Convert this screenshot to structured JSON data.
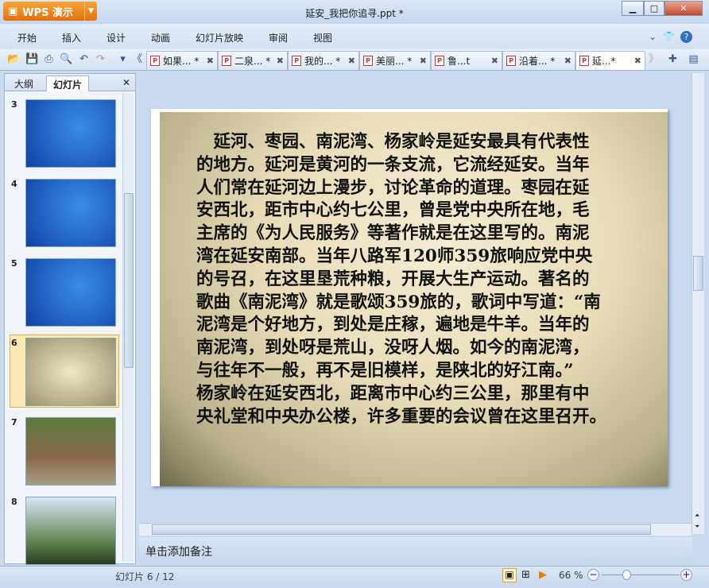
{
  "app": {
    "logo": "WPS 演示",
    "title": "延安_我把你追寻.ppt *"
  },
  "window": {
    "minimize": "▁",
    "maximize": "□",
    "close": "✕"
  },
  "menu": [
    "开始",
    "插入",
    "设计",
    "动画",
    "幻灯片放映",
    "审阅",
    "视图"
  ],
  "doc_tabs": [
    {
      "label": "如果... *",
      "active": false
    },
    {
      "label": "二泉... *",
      "active": false
    },
    {
      "label": "我的... *",
      "active": false
    },
    {
      "label": "美丽... *",
      "active": false
    },
    {
      "label": "鲁...t",
      "active": false
    },
    {
      "label": "沿着... *",
      "active": false
    },
    {
      "label": "延...*",
      "active": true
    }
  ],
  "left_pane": {
    "tabs": [
      "大纲",
      "幻灯片"
    ],
    "active_tab": "幻灯片",
    "close": "✕",
    "thumbnails": [
      {
        "num": "3"
      },
      {
        "num": "4"
      },
      {
        "num": "5"
      },
      {
        "num": "6",
        "selected": true
      },
      {
        "num": "7"
      },
      {
        "num": "8"
      }
    ]
  },
  "slide": {
    "lines": [
      "　延河、枣园、南泥湾、杨家岭是延安最具有代表性",
      "的地方。延河是黄河的一条支流，它流经延安。当年",
      "人们常在延河边上漫步，讨论革命的道理。枣园在延",
      "安西北，距市中心约七公里，曾是党中央所在地，毛",
      "主席的《为人民服务》等著作就是在这里写的。南泥",
      "湾在延安南部。当年八路军120师359旅响应党中央",
      "的号召，在这里垦荒种粮，开展大生产运动。著名的",
      "歌曲《南泥湾》就是歌颂359旅的，歌词中写道：“南",
      "泥湾是个好地方，到处是庄稼，遍地是牛羊。当年的",
      "南泥湾，到处呀是荒山，没呀人烟。如今的南泥湾，",
      "与往年不一般，再不是旧模样，是陕北的好江南。”",
      "杨家岭在延安西北，距离市中心约三公里，那里有中",
      "央礼堂和中央办公楼，许多重要的会议曾在这里召开。"
    ]
  },
  "notes_placeholder": "单击添加备注",
  "status": {
    "slide_counter": "幻灯片 6 / 12",
    "zoom": "66 %",
    "zoom_percent": 66
  }
}
